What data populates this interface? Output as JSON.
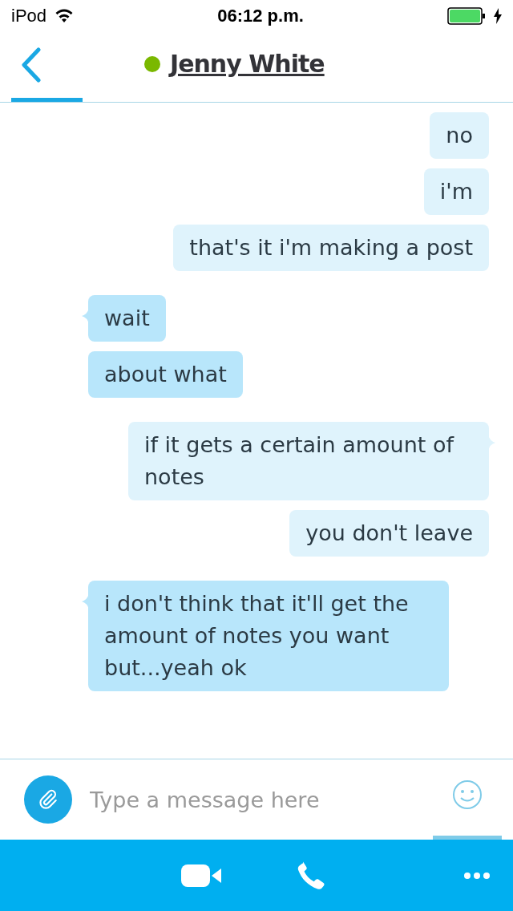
{
  "status_bar": {
    "carrier": "iPod",
    "time": "06:12 p.m.",
    "charging": true
  },
  "header": {
    "contact": "Jenny White",
    "online": true
  },
  "messages": [
    {
      "kind": "sent",
      "text": "no",
      "tail": false
    },
    {
      "kind": "sent",
      "text": "i'm",
      "tail": false
    },
    {
      "kind": "sent",
      "text": "that's it i'm making a post",
      "tail": false
    },
    {
      "kind": "received",
      "text": "wait",
      "tail": true
    },
    {
      "kind": "received",
      "text": "about what",
      "tail": false
    },
    {
      "kind": "sent",
      "text": "if it gets a certain amount of notes",
      "tail": true
    },
    {
      "kind": "sent",
      "text": "you don't leave",
      "tail": false
    },
    {
      "kind": "received",
      "text": "i don't think that it'll get the amount of notes you want but...yeah ok",
      "tail": true
    }
  ],
  "composer": {
    "placeholder": "Type a message here"
  }
}
